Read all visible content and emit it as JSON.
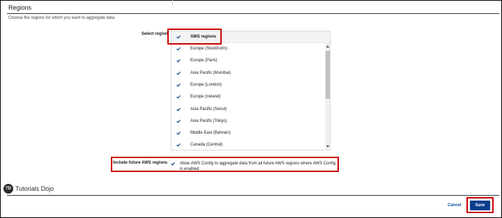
{
  "section": {
    "title": "Regions",
    "description": "Choose the regions for which you want to aggregate data."
  },
  "select_region": {
    "label": "Select region",
    "table_header": "AWS regions",
    "header_checked": true,
    "regions": [
      {
        "name": "Europe (Stockholm)",
        "checked": true
      },
      {
        "name": "Europe (Paris)",
        "checked": true
      },
      {
        "name": "Asia Pacific (Mumbai)",
        "checked": true
      },
      {
        "name": "Europe (London)",
        "checked": true
      },
      {
        "name": "Europe (Ireland)",
        "checked": true
      },
      {
        "name": "Asia Pacific (Seoul)",
        "checked": true
      },
      {
        "name": "Asia Pacific (Tokyo)",
        "checked": true
      },
      {
        "name": "Middle East (Bahrain)",
        "checked": true
      },
      {
        "name": "Canada (Central)",
        "checked": true
      }
    ]
  },
  "future_regions": {
    "label": "Include future AWS regions",
    "checked": true,
    "description": "Allow AWS Config to aggregate data from all future AWS regions where AWS Config is enabled."
  },
  "brand": {
    "logo_text": "TD",
    "name": "Tutorials Dojo"
  },
  "actions": {
    "cancel_label": "Cancel",
    "save_label": "Save"
  },
  "colors": {
    "accent": "#0a3d8c",
    "link": "#0d4fa0",
    "highlight": "#cc0000",
    "checkbox": "#0a3d8c"
  }
}
